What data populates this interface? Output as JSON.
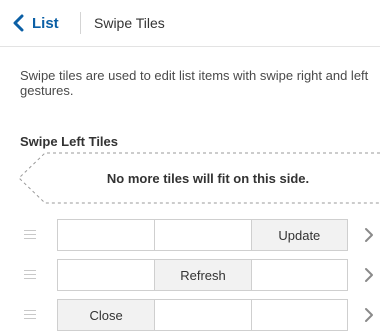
{
  "header": {
    "back_label": "List",
    "title": "Swipe Tiles"
  },
  "description": "Swipe tiles are used to edit list items with swipe right and left gestures.",
  "section": {
    "title": "Swipe Left Tiles",
    "empty_message": "No more tiles will fit on this side."
  },
  "rows": [
    {
      "cells": [
        "",
        "",
        "Update"
      ]
    },
    {
      "cells": [
        "",
        "Refresh",
        ""
      ]
    },
    {
      "cells": [
        "Close",
        "",
        ""
      ]
    }
  ],
  "colors": {
    "accent": "#0b5fa5",
    "tile_fill": "#f2f2f2",
    "border": "#cfcfcf"
  },
  "icons": {
    "back": "chevron-left-icon",
    "drag": "drag-handle-icon",
    "row_action": "chevron-right-icon"
  }
}
